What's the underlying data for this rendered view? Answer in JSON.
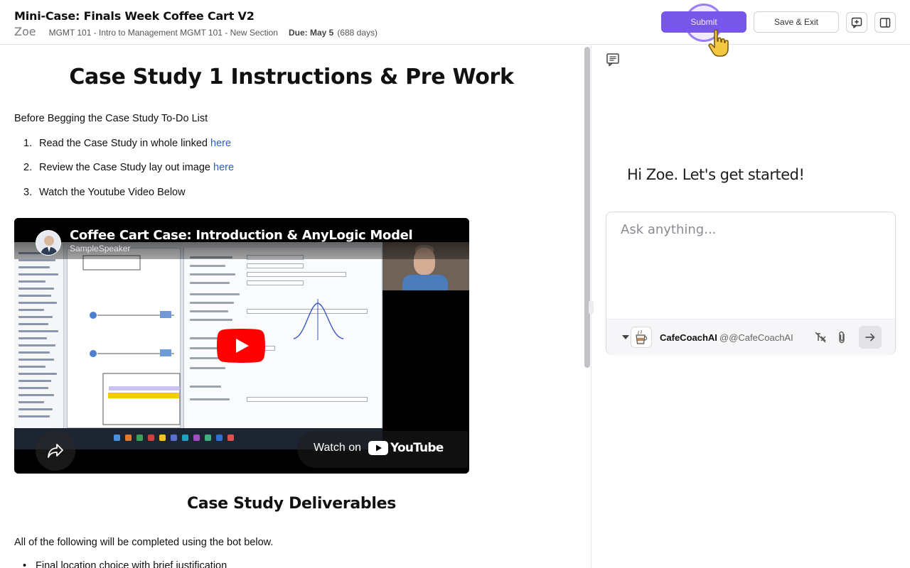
{
  "header": {
    "title": "Mini-Case: Finals Week Coffee Cart V2",
    "user_name": "Zoe",
    "course": "MGMT 101 - Intro to Management MGMT 101 - New Section",
    "due_label": "Due: May 5",
    "due_days": "(688 days)",
    "submit_label": "Submit",
    "save_exit_label": "Save & Exit"
  },
  "content": {
    "heading": "Case Study 1 Instructions & Pre Work",
    "intro": "Before Begging the Case Study To-Do List",
    "steps": [
      {
        "num": "1.",
        "text": "Read the Case Study in whole linked ",
        "link": "here"
      },
      {
        "num": "2.",
        "text": "Review the Case Study lay out image ",
        "link": "here"
      },
      {
        "num": "3.",
        "text": "Watch the Youtube Video Below",
        "link": ""
      }
    ],
    "video": {
      "title": "Coffee Cart Case: Introduction & AnyLogic Model",
      "channel": "SampleSpeaker",
      "watch_on": "Watch on",
      "platform": "YouTube"
    },
    "deliverables_heading": "Case Study Deliverables",
    "deliverables_intro": "All of the following will be completed using the bot below.",
    "deliverables": [
      "Final location choice with brief justification"
    ]
  },
  "chat": {
    "greeting": "Hi Zoe. Let's get started!",
    "input_placeholder": "Ask anything...",
    "bot_name": "CafeCoachAI",
    "bot_handle": "@@CafeCoachAI"
  },
  "colors": {
    "accent": "#7657e8",
    "link": "#2f5bd4",
    "youtube_red": "#ff0000"
  },
  "icons": {
    "add_comment": "message-plus-icon",
    "side_panel": "panel-toggle-icon",
    "comment": "comment-icon",
    "tools_off": "tools-off-icon",
    "attach": "paperclip-icon",
    "send": "arrow-right-icon"
  }
}
